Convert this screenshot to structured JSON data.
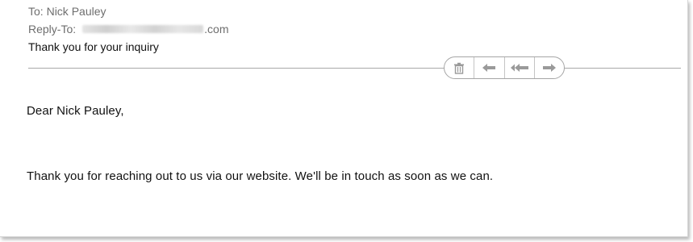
{
  "header": {
    "to_label": "To:",
    "to_value": "Nick Pauley",
    "reply_to_label": "Reply-To:",
    "reply_to_domain": ".com",
    "subject": "Thank you for your inquiry"
  },
  "actions": {
    "delete_icon": "trash-icon",
    "reply_icon": "reply-arrow-icon",
    "reply_all_icon": "reply-all-arrow-icon",
    "forward_icon": "forward-arrow-icon"
  },
  "message": {
    "greeting": "Dear Nick Pauley,",
    "body": "Thank you for reaching out to us via our website. We'll be in touch as soon as we can."
  },
  "colors": {
    "header_gray": "#6e6e6e",
    "text": "#111111",
    "divider": "#a9a9a9"
  }
}
